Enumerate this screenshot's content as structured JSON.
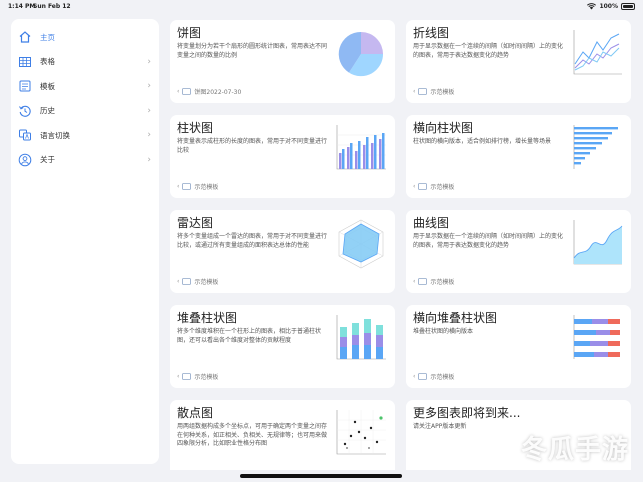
{
  "status": {
    "time": "1:14 PM",
    "date": "Sun Feb 12",
    "battery": "100%"
  },
  "sidebar": {
    "items": [
      {
        "label": "主页",
        "icon": "home-icon",
        "active": true
      },
      {
        "label": "表格",
        "icon": "table-icon"
      },
      {
        "label": "模板",
        "icon": "template-icon"
      },
      {
        "label": "历史",
        "icon": "history-icon"
      },
      {
        "label": "语言切换",
        "icon": "language-icon"
      },
      {
        "label": "关于",
        "icon": "person-icon"
      }
    ]
  },
  "cards": [
    {
      "title": "饼图",
      "desc": "将变量划分为若干个扇形的圆形统计图表，常用表达不同变量之间的数量的比例",
      "foot": "饼图2022-07-30",
      "thumb": "pie-chart-thumbnail"
    },
    {
      "title": "折线图",
      "desc": "用于显示数据在一个连续的间隔（如时间间隔）上的变化的图表，常用于表达数据变化的趋势",
      "foot": "示范模板",
      "thumb": "line-chart-thumbnail"
    },
    {
      "title": "柱状图",
      "desc": "将变量表示成柱形的长度的图表，常用于对不同变量进行比较",
      "foot": "示范模板",
      "thumb": "bar-chart-thumbnail"
    },
    {
      "title": "横向柱状图",
      "desc": "柱状图的横向版本，适合例如排行榜，增长量等场景",
      "foot": "示范模板",
      "thumb": "horizontal-bar-thumbnail"
    },
    {
      "title": "雷达图",
      "desc": "将多个变量组成一个雷达的图表，常用于对不同变量进行比较，或通过所有变量组成的面积表达总体的性能",
      "foot": "示范模板",
      "thumb": "radar-chart-thumbnail"
    },
    {
      "title": "曲线图",
      "desc": "用于显示数据在一个连续的间隔（如时间间隔）上的变化的图表，常用于表达数据变化的趋势",
      "foot": "示范模板",
      "thumb": "area-chart-thumbnail"
    },
    {
      "title": "堆叠柱状图",
      "desc": "将多个维度堆积在一个柱形上的图表，相比于普通柱状图，还可以看出各个维度对整体的贡献程度",
      "foot": "示范模板",
      "thumb": "stacked-bar-thumbnail"
    },
    {
      "title": "横向堆叠柱状图",
      "desc": "堆叠柱状图的横向版本",
      "foot": "示范模板",
      "thumb": "horizontal-stacked-thumbnail"
    },
    {
      "title": "散点图",
      "desc": "用两组数据构成多个坐标点，可用于确定两个变量之间存在何种关系，如正相关、负相关、无规律等；也可用来做四象限分析，比如职业性格分布图",
      "foot": "",
      "thumb": "scatter-chart-thumbnail"
    },
    {
      "title": "更多图表即将到来...",
      "desc": "请关注APP版本更新",
      "foot": "",
      "thumb": ""
    }
  ],
  "watermark": "冬瓜手游",
  "colors": {
    "accent": "#3f7fe6",
    "chart_blue": "#5aa6f5",
    "chart_purple": "#9a8ee8",
    "chart_teal": "#7fe0dc",
    "chart_red": "#ef6a5b"
  }
}
